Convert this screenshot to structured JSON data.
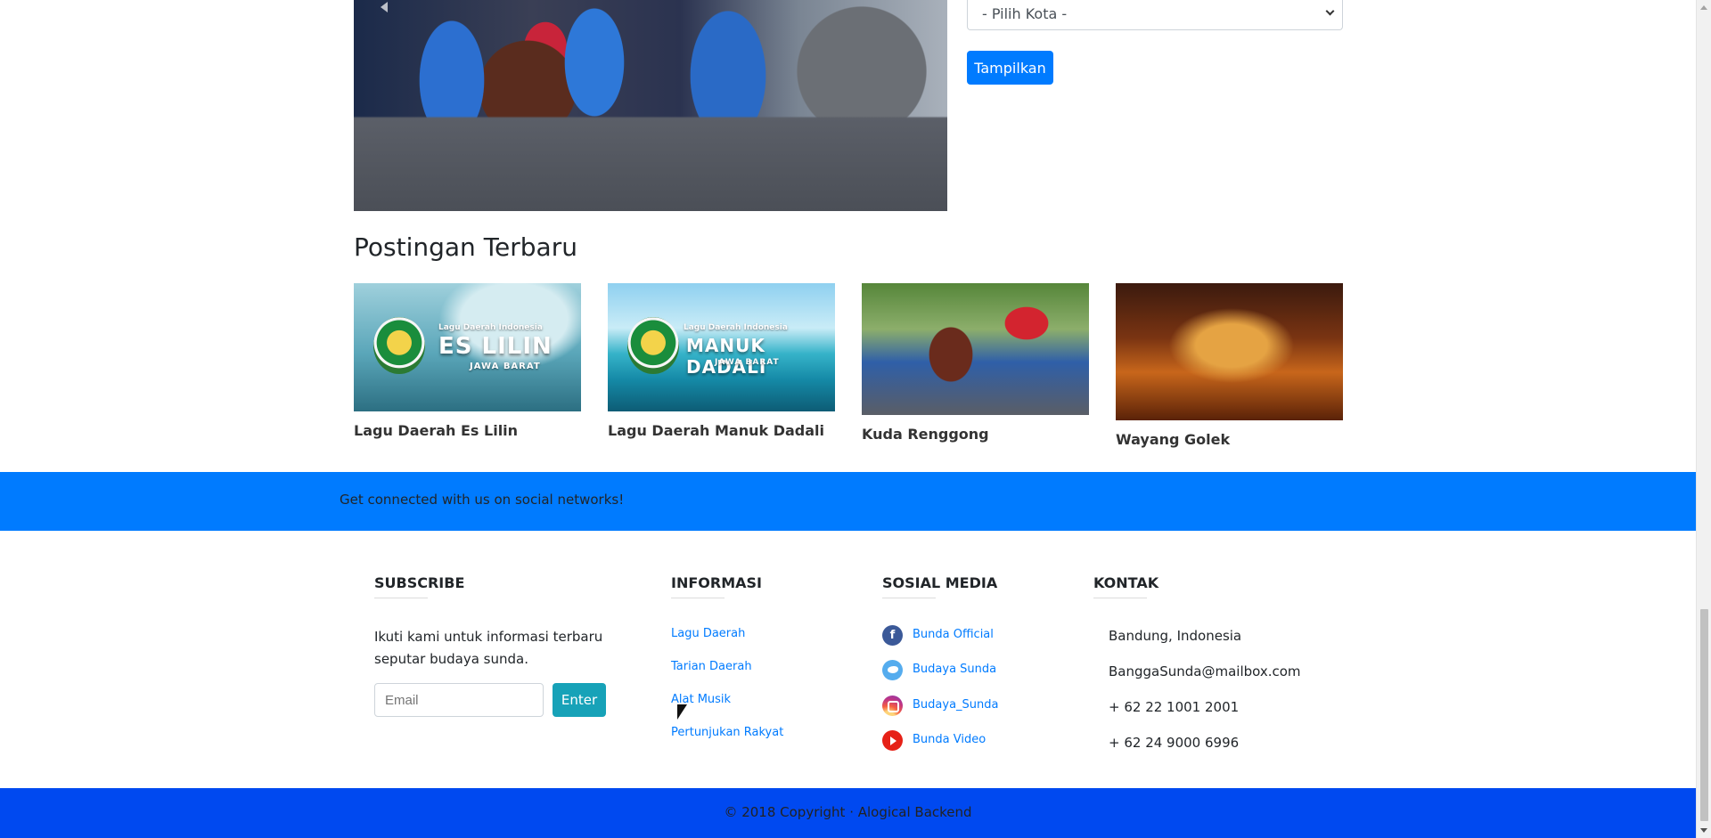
{
  "filter": {
    "city_select_value": "- Pilih Kota -",
    "show_button": "Tampilkan"
  },
  "latest": {
    "title": "Postingan Terbaru",
    "posts": [
      {
        "caption": "Lagu Daerah Es Lilin",
        "overlay_small": "Lagu Daerah Indonesia",
        "overlay_big": "ES LILIN",
        "overlay_sub": "JAWA BARAT"
      },
      {
        "caption": "Lagu Daerah Manuk Dadali",
        "overlay_small": "Lagu Daerah Indonesia",
        "overlay_big": "MANUK DADALI",
        "overlay_sub": "JAWA BARAT"
      },
      {
        "caption": "Kuda Renggong"
      },
      {
        "caption": "Wayang Golek"
      }
    ]
  },
  "social_band": {
    "text": "Get connected with us on social networks!"
  },
  "footer": {
    "subscribe": {
      "title": "SUBSCRIBE",
      "text": "Ikuti kami untuk informasi terbaru seputar budaya sunda.",
      "email_placeholder": "Email",
      "enter_button": "Enter"
    },
    "informasi": {
      "title": "INFORMASI",
      "links": [
        "Lagu Daerah",
        "Tarian Daerah",
        "Alat Musik",
        "Pertunjukan Rakyat"
      ]
    },
    "sosial_media": {
      "title": "SOSIAL MEDIA",
      "items": [
        {
          "label": "Bunda Official",
          "icon": "facebook-icon"
        },
        {
          "label": "Budaya Sunda",
          "icon": "twitter-icon"
        },
        {
          "label": "Budaya_Sunda",
          "icon": "instagram-icon"
        },
        {
          "label": "Bunda Video",
          "icon": "youtube-icon"
        }
      ]
    },
    "kontak": {
      "title": "KONTAK",
      "items": [
        "Bandung, Indonesia",
        "BanggaSunda@mailbox.com",
        "+ 62 22 1001 2001",
        "+ 62 24 9000 6996"
      ]
    }
  },
  "copyright": "© 2018 Copyright · Alogical Backend",
  "colors": {
    "primary": "#007bff",
    "info": "#17a2b8",
    "copyright_bar": "#0049f0"
  }
}
